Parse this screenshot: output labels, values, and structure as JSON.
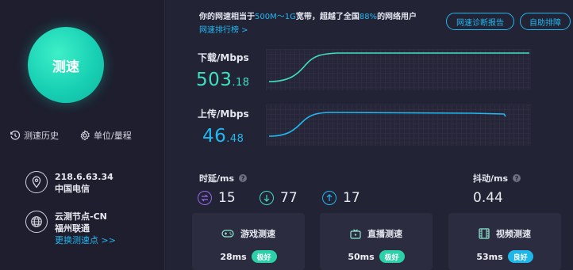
{
  "left": {
    "speed_button": "测速",
    "tools": [
      {
        "label": "测速历史",
        "icon": "history-icon"
      },
      {
        "label": "单位/量程",
        "icon": "gear-icon"
      }
    ],
    "ip": {
      "address": "218.6.63.34",
      "isp": "中国电信",
      "icon": "location-pin-icon"
    },
    "node": {
      "name": "云测节点-CN",
      "location": "福州联通",
      "link": "更换测速点 >>",
      "icon": "globe-icon"
    }
  },
  "header": {
    "text_1": "你的网速相当于",
    "bandwidth": "500M～1G",
    "text_2": "宽带，超越了全国",
    "percent": "88%",
    "text_3": "的网络用户",
    "rank_link": "网速排行榜 >",
    "report_button": "网速诊断报告",
    "troubleshoot_button": "自助排障"
  },
  "download": {
    "label": "下载/Mbps",
    "int": "503",
    "dec": ".18",
    "color": "#3ee0c0"
  },
  "upload": {
    "label": "上传/Mbps",
    "int": "46",
    "dec": ".48",
    "color": "#22b8f0"
  },
  "latency": {
    "label": "时延/ms",
    "items": [
      {
        "value": "15",
        "icon": "swap-icon",
        "color": "#9b6cf0"
      },
      {
        "value": "77",
        "icon": "arrow-down-icon",
        "color": "#3ee0c0"
      },
      {
        "value": "17",
        "icon": "arrow-up-icon",
        "color": "#22b8f0"
      }
    ]
  },
  "jitter": {
    "label": "抖动/ms",
    "value": "0.44"
  },
  "cards": [
    {
      "title": "游戏测速",
      "icon": "gamepad-icon",
      "ms": "28ms",
      "badge": "极好",
      "badge_color": "#2bd1a8"
    },
    {
      "title": "直播测速",
      "icon": "tv-icon",
      "ms": "50ms",
      "badge": "极好",
      "badge_color": "#2bd1a8"
    },
    {
      "title": "视频测速",
      "icon": "film-icon",
      "ms": "53ms",
      "badge": "良好",
      "badge_color": "#1fb6ea"
    }
  ],
  "question_mark": "?"
}
